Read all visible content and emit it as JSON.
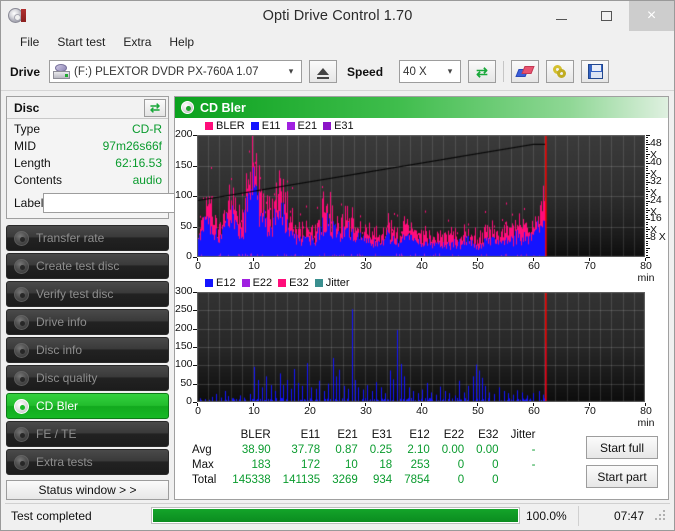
{
  "window": {
    "title": "Opti Drive Control 1.70",
    "icon": "disc-icon",
    "minimize": "–",
    "maximize": "□",
    "close": "×"
  },
  "menu": {
    "items": [
      {
        "label": "File"
      },
      {
        "label": "Start test"
      },
      {
        "label": "Extra"
      },
      {
        "label": "Help"
      }
    ]
  },
  "toolbar": {
    "drive_label": "Drive",
    "drive_value": "(F:)  PLEXTOR DVDR  PX-760A 1.07",
    "eject_icon": "eject-icon",
    "speed_label": "Speed",
    "speed_value": "40 X",
    "refresh_icon": "refresh-icon",
    "erase_icon": "erase-disc-icon",
    "tools_icon": "tools-icon",
    "save_icon": "save-icon",
    "dropdown_arrow": "⌄"
  },
  "disc_panel": {
    "title": "Disc",
    "refresh_icon": "refresh-icon",
    "rows": [
      {
        "key": "Type",
        "value": "CD-R"
      },
      {
        "key": "MID",
        "value": "97m26s66f"
      },
      {
        "key": "Length",
        "value": "62:16.53"
      },
      {
        "key": "Contents",
        "value": "audio"
      }
    ],
    "label_key": "Label",
    "label_value": "",
    "label_placeholder": "",
    "cd_button_icon": "cd-disc-icon"
  },
  "sidebar": {
    "items": [
      {
        "label": "Transfer rate",
        "icon": "disc-icon",
        "active": false
      },
      {
        "label": "Create test disc",
        "icon": "disc-icon",
        "active": false
      },
      {
        "label": "Verify test disc",
        "icon": "disc-icon",
        "active": false
      },
      {
        "label": "Drive info",
        "icon": "disc-icon",
        "active": false
      },
      {
        "label": "Disc info",
        "icon": "disc-icon",
        "active": false
      },
      {
        "label": "Disc quality",
        "icon": "disc-icon",
        "active": false
      },
      {
        "label": "CD Bler",
        "icon": "disc-icon",
        "active": true
      },
      {
        "label": "FE / TE",
        "icon": "disc-icon",
        "active": false
      },
      {
        "label": "Extra tests",
        "icon": "disc-icon",
        "active": false
      }
    ],
    "status_window_label": "Status window > >"
  },
  "panel": {
    "title": "CD Bler",
    "icon": "disc-icon"
  },
  "buttons": {
    "start_full": "Start full",
    "start_part": "Start part"
  },
  "statusbar": {
    "message": "Test completed",
    "percent_label": "100.0%",
    "percent_value": 100,
    "elapsed": "07:47"
  },
  "stats": {
    "columns": [
      "BLER",
      "E11",
      "E21",
      "E31",
      "E12",
      "E22",
      "E32",
      "Jitter"
    ],
    "rows": [
      {
        "label": "Avg",
        "values": [
          "38.90",
          "37.78",
          "0.87",
          "0.25",
          "2.10",
          "0.00",
          "0.00",
          "-"
        ]
      },
      {
        "label": "Max",
        "values": [
          "183",
          "172",
          "10",
          "18",
          "253",
          "0",
          "0",
          "-"
        ]
      },
      {
        "label": "Total",
        "values": [
          "145338",
          "141135",
          "3269",
          "934",
          "7854",
          "0",
          "0",
          ""
        ]
      }
    ]
  },
  "chart_data": [
    {
      "id": "bler-chart",
      "type": "area",
      "title": "CD Bler",
      "xlabel": "min",
      "ylabel": "",
      "xlim": [
        0,
        80
      ],
      "ylim": [
        0,
        200
      ],
      "yticks": [
        0,
        50,
        100,
        150,
        200
      ],
      "xticks": [
        0,
        10,
        20,
        30,
        40,
        50,
        60,
        70,
        80
      ],
      "xtick_labels": [
        "0",
        "10",
        "20",
        "30",
        "40",
        "50",
        "60",
        "70",
        "80 min"
      ],
      "y2label": "",
      "y2ticks": [
        8,
        16,
        24,
        32,
        40,
        48
      ],
      "y2tick_labels": [
        "8 X",
        "16 X",
        "24 X",
        "32 X",
        "40 X",
        "48 X"
      ],
      "y2lim": [
        0,
        52
      ],
      "grid": true,
      "legend": [
        {
          "name": "BLER",
          "color": "#ff0d7a"
        },
        {
          "name": "E11",
          "color": "#1414ff"
        },
        {
          "name": "E21",
          "color": "#a020e0"
        },
        {
          "name": "E31",
          "color": "#8c14c8"
        }
      ],
      "legend_position": "top-left",
      "data_end_min": 62.3,
      "marker_min": 62.3,
      "marker_color": "#ff0000",
      "series": [
        {
          "name": "BLER",
          "color": "#ff0d7a",
          "x": [
            0,
            1,
            2,
            3,
            4,
            5,
            6,
            7,
            8,
            9,
            10,
            11,
            12,
            13,
            14,
            15,
            16,
            17,
            18,
            19,
            20,
            21,
            22,
            23,
            24,
            25,
            26,
            27,
            28,
            29,
            30,
            31,
            32,
            33,
            34,
            35,
            36,
            37,
            38,
            39,
            40,
            41,
            42,
            43,
            44,
            45,
            46,
            47,
            48,
            49,
            50,
            51,
            52,
            53,
            54,
            55,
            56,
            57,
            58,
            59,
            60,
            61,
            62
          ],
          "values": [
            30,
            80,
            92,
            60,
            45,
            75,
            110,
            80,
            60,
            140,
            183,
            130,
            95,
            70,
            105,
            120,
            95,
            60,
            50,
            48,
            45,
            42,
            70,
            95,
            80,
            60,
            62,
            70,
            58,
            50,
            45,
            42,
            40,
            38,
            55,
            45,
            40,
            58,
            50,
            42,
            40,
            38,
            36,
            35,
            34,
            33,
            40,
            38,
            45,
            36,
            34,
            40,
            48,
            42,
            38,
            45,
            50,
            55,
            52,
            50,
            58,
            75,
            90
          ]
        },
        {
          "name": "E11",
          "color": "#1414ff",
          "x": [
            0,
            1,
            2,
            3,
            4,
            5,
            6,
            7,
            8,
            9,
            10,
            11,
            12,
            13,
            14,
            15,
            16,
            17,
            18,
            19,
            20,
            21,
            22,
            23,
            24,
            25,
            26,
            27,
            28,
            29,
            30,
            31,
            32,
            33,
            34,
            35,
            36,
            37,
            38,
            39,
            40,
            41,
            42,
            43,
            44,
            45,
            46,
            47,
            48,
            49,
            50,
            51,
            52,
            53,
            54,
            55,
            56,
            57,
            58,
            59,
            60,
            61,
            62
          ],
          "values": [
            26,
            68,
            80,
            52,
            38,
            66,
            98,
            70,
            50,
            125,
            172,
            118,
            84,
            60,
            92,
            108,
            82,
            50,
            42,
            40,
            38,
            36,
            60,
            84,
            70,
            52,
            54,
            60,
            50,
            42,
            38,
            35,
            33,
            31,
            46,
            38,
            33,
            50,
            42,
            35,
            33,
            31,
            30,
            29,
            28,
            27,
            33,
            31,
            38,
            30,
            28,
            33,
            40,
            35,
            31,
            38,
            42,
            47,
            44,
            42,
            50,
            65,
            78
          ]
        },
        {
          "name": "E21",
          "color": "#a020e0",
          "x": [
            0,
            10,
            20,
            30,
            40,
            50,
            60,
            62
          ],
          "values": [
            3,
            10,
            4,
            3,
            2,
            2,
            3,
            4
          ]
        },
        {
          "name": "E31",
          "color": "#8c14c8",
          "x": [
            0,
            10,
            20,
            30,
            40,
            50,
            60,
            62
          ],
          "values": [
            2,
            18,
            3,
            2,
            2,
            1,
            2,
            3
          ]
        },
        {
          "name": "Speed",
          "color": "#111111",
          "x": [
            0,
            10,
            20,
            30,
            40,
            50,
            60,
            62
          ],
          "values": [
            24,
            28,
            32,
            36,
            40,
            44,
            48,
            48
          ]
        }
      ]
    },
    {
      "id": "e12-chart",
      "type": "line",
      "title": "",
      "xlabel": "min",
      "ylabel": "",
      "xlim": [
        0,
        80
      ],
      "ylim": [
        0,
        300
      ],
      "yticks": [
        0,
        50,
        100,
        150,
        200,
        250,
        300
      ],
      "xticks": [
        0,
        10,
        20,
        30,
        40,
        50,
        60,
        70,
        80
      ],
      "xtick_labels": [
        "0",
        "10",
        "20",
        "30",
        "40",
        "50",
        "60",
        "70",
        "80 min"
      ],
      "grid": true,
      "legend": [
        {
          "name": "E12",
          "color": "#1414ff"
        },
        {
          "name": "E22",
          "color": "#a020e0"
        },
        {
          "name": "E32",
          "color": "#ff0d7a"
        },
        {
          "name": "Jitter",
          "color": "#3a8f8f"
        }
      ],
      "legend_position": "top-left",
      "data_end_min": 62.3,
      "marker_min": 62.3,
      "marker_color": "#ff0000",
      "series": [
        {
          "name": "E12",
          "color": "#1414ff",
          "peaks": [
            [
              0.6,
              10
            ],
            [
              1.4,
              8
            ],
            [
              2.6,
              14
            ],
            [
              3.4,
              22
            ],
            [
              4.2,
              12
            ],
            [
              5.0,
              30
            ],
            [
              5.6,
              16
            ],
            [
              6.4,
              10
            ],
            [
              7.6,
              18
            ],
            [
              8.4,
              12
            ],
            [
              9.4,
              22
            ],
            [
              10.2,
              96
            ],
            [
              10.9,
              60
            ],
            [
              11.6,
              40
            ],
            [
              12.4,
              70
            ],
            [
              13.2,
              46
            ],
            [
              14.0,
              30
            ],
            [
              14.8,
              78
            ],
            [
              15.4,
              46
            ],
            [
              16.0,
              60
            ],
            [
              16.8,
              36
            ],
            [
              17.4,
              90
            ],
            [
              18.0,
              52
            ],
            [
              18.8,
              44
            ],
            [
              19.6,
              106
            ],
            [
              20.4,
              40
            ],
            [
              21.2,
              36
            ],
            [
              21.8,
              58
            ],
            [
              22.6,
              30
            ],
            [
              23.4,
              50
            ],
            [
              24.2,
              120
            ],
            [
              24.8,
              70
            ],
            [
              25.4,
              88
            ],
            [
              26.2,
              44
            ],
            [
              27.0,
              36
            ],
            [
              27.6,
              253
            ],
            [
              28.2,
              60
            ],
            [
              28.8,
              40
            ],
            [
              29.6,
              34
            ],
            [
              30.4,
              46
            ],
            [
              31.2,
              30
            ],
            [
              32.0,
              54
            ],
            [
              32.8,
              40
            ],
            [
              33.6,
              24
            ],
            [
              34.4,
              86
            ],
            [
              35.0,
              62
            ],
            [
              35.8,
              196
            ],
            [
              36.4,
              104
            ],
            [
              37.0,
              70
            ],
            [
              37.8,
              40
            ],
            [
              38.6,
              30
            ],
            [
              39.4,
              24
            ],
            [
              40.2,
              34
            ],
            [
              41.0,
              52
            ],
            [
              41.8,
              26
            ],
            [
              42.6,
              20
            ],
            [
              43.4,
              42
            ],
            [
              44.2,
              30
            ],
            [
              45.0,
              24
            ],
            [
              46.0,
              18
            ],
            [
              46.8,
              58
            ],
            [
              47.6,
              26
            ],
            [
              48.4,
              44
            ],
            [
              49.2,
              70
            ],
            [
              49.8,
              102
            ],
            [
              50.4,
              86
            ],
            [
              50.9,
              66
            ],
            [
              51.4,
              44
            ],
            [
              52.2,
              26
            ],
            [
              53.0,
              22
            ],
            [
              54.0,
              40
            ],
            [
              54.8,
              30
            ],
            [
              55.6,
              24
            ],
            [
              56.4,
              20
            ],
            [
              57.2,
              32
            ],
            [
              58.0,
              26
            ],
            [
              59.0,
              18
            ],
            [
              60.0,
              24
            ],
            [
              61.0,
              30
            ],
            [
              61.8,
              20
            ],
            [
              62.2,
              160
            ]
          ]
        },
        {
          "name": "E22",
          "color": "#a020e0",
          "peaks": []
        },
        {
          "name": "E32",
          "color": "#ff0d7a",
          "peaks": []
        },
        {
          "name": "Jitter",
          "color": "#3a8f8f",
          "peaks": []
        }
      ]
    }
  ]
}
